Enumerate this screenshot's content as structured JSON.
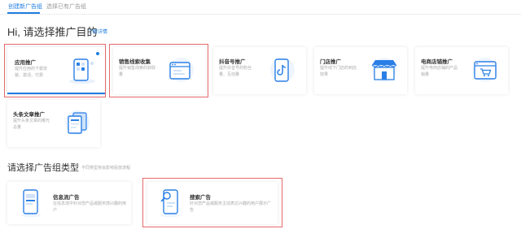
{
  "tabs": [
    {
      "label": "创建新广告组",
      "active": true
    },
    {
      "label": "选择已有广告组",
      "active": false
    }
  ],
  "page": {
    "title": "Hi, 请选择推广目的",
    "learn_more": "了解详情"
  },
  "objectives": [
    {
      "title": "应用推广",
      "desc": "提升应用的下载安装、激活、付费",
      "icon": "phone-app-icon",
      "selected": true
    },
    {
      "title": "销售线索收集",
      "desc": "提升销售线索的获取量",
      "icon": "browser-window-icon",
      "selected": false
    },
    {
      "title": "抖音号推广",
      "desc": "提升抖音号的粉丝量、互动量",
      "icon": "douyin-phone-icon",
      "selected": false
    },
    {
      "title": "门店推广",
      "desc": "提升线下门店的到店效果",
      "icon": "storefront-icon",
      "selected": false
    },
    {
      "title": "电商店铺推广",
      "desc": "提升电商店铺的产品销量",
      "icon": "shop-cart-window-icon",
      "selected": false
    },
    {
      "title": "头条文章推广",
      "desc": "提升头条文章的曝光总量",
      "icon": "article-cards-icon",
      "selected": false
    }
  ],
  "section": {
    "title": "请选择广告组类型",
    "hint": "不同类型将会影响投放流程"
  },
  "ad_types": [
    {
      "title": "信息流广告",
      "desc": "在信息流中针对您产品或服务感兴趣的用户",
      "icon": "feed-phone-icon"
    },
    {
      "title": "搜索广告",
      "desc": "针对您产品或服务主动表达兴趣的用户展示广告",
      "icon": "search-phone-icon"
    }
  ],
  "colors": {
    "accent": "#1f7de0",
    "highlight_box": "#e66a6a",
    "icon_blue": "#2a7fe6",
    "icon_light": "#cfe2f8"
  }
}
